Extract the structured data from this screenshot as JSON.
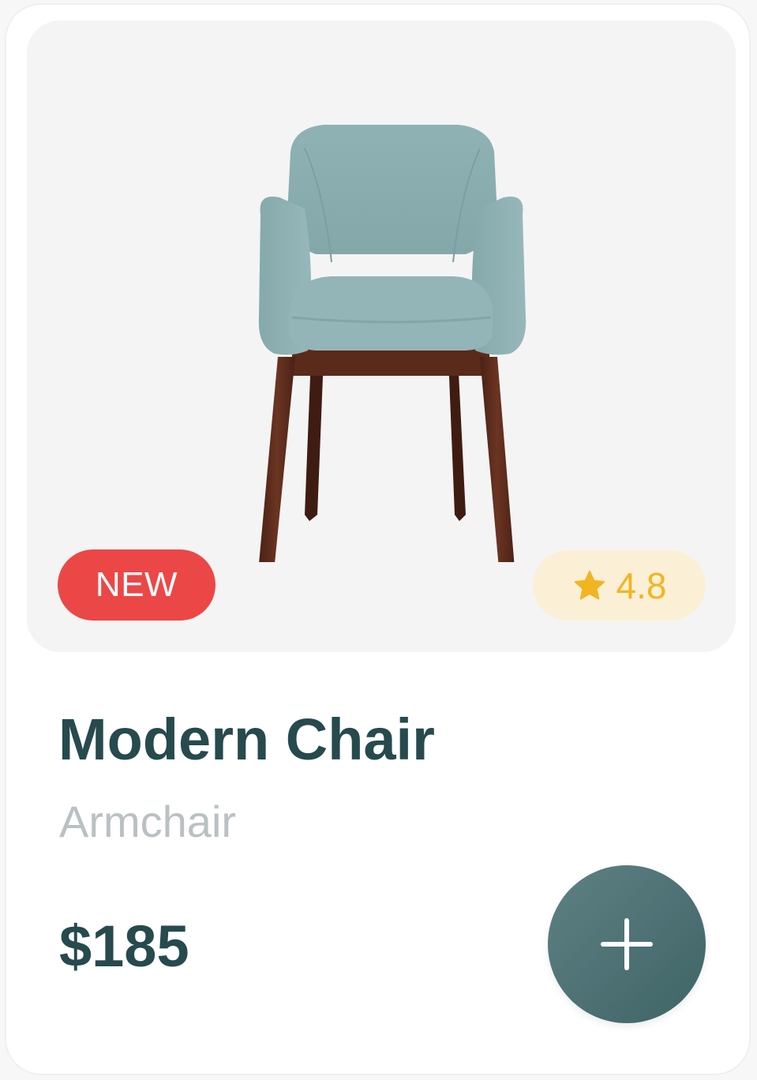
{
  "product": {
    "badge_label": "NEW",
    "rating": "4.8",
    "name": "Modern Chair",
    "category": "Armchair",
    "price": "$185"
  },
  "icons": {
    "rating": "star-icon",
    "add": "plus-icon"
  },
  "colors": {
    "card_background": "#ffffff",
    "image_panel_background": "#f4f4f4",
    "badge_new_background": "#ec4747",
    "badge_new_text": "#ffffff",
    "rating_background": "#fbf0d6",
    "rating_accent": "#f2b521",
    "title_text": "#264a4d",
    "subtitle_text": "#b9c1c3",
    "add_button": "#4d7173",
    "chair_fabric": "#8fb1b3",
    "chair_wood": "#5a2a1b"
  }
}
